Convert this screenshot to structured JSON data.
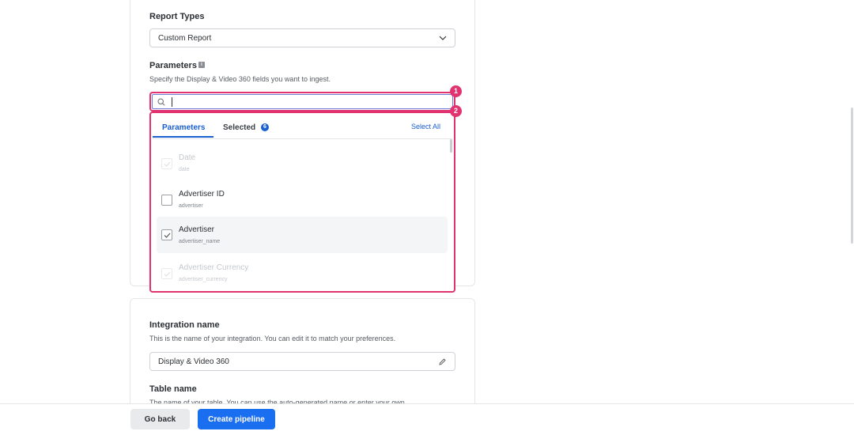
{
  "report_types": {
    "label": "Report Types",
    "selected": "Custom Report"
  },
  "parameters": {
    "label": "Parameters",
    "help": "Specify the Display & Video 360 fields you want to ingest.",
    "search_value": "",
    "tabs": {
      "parameters": "Parameters",
      "selected": "Selected",
      "selected_count": "6"
    },
    "select_all": "Select All",
    "items": [
      {
        "title": "Date",
        "sub": "date",
        "checked": true,
        "disabled": true
      },
      {
        "title": "Advertiser ID",
        "sub": "advertiser",
        "checked": false,
        "disabled": false
      },
      {
        "title": "Advertiser",
        "sub": "advertiser_name",
        "checked": true,
        "disabled": false
      },
      {
        "title": "Advertiser Currency",
        "sub": "advertiser_currency",
        "checked": true,
        "disabled": true
      }
    ]
  },
  "callouts": [
    "1",
    "2"
  ],
  "integration": {
    "label": "Integration name",
    "help": "This is the name of your integration. You can edit it to match your preferences.",
    "value": "Display & Video 360"
  },
  "table": {
    "label": "Table name",
    "help": "The name of your table. You can use the auto-generated name or enter your own."
  },
  "footer": {
    "back": "Go back",
    "create": "Create pipeline"
  },
  "colors": {
    "accent": "#1a6ef0",
    "highlight": "#e0336f"
  }
}
